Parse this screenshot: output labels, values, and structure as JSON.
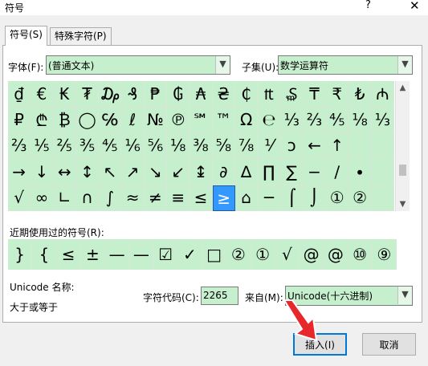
{
  "window": {
    "title": "符号",
    "help_glyph": "?",
    "close_glyph": "✕"
  },
  "tabs": [
    {
      "label": "符号(S)",
      "active": true
    },
    {
      "label": "特殊字符(P)",
      "active": false
    }
  ],
  "font": {
    "label": "字体(F):",
    "value": "(普通文本)"
  },
  "subset": {
    "label": "子集(U):",
    "value": "数学运算符"
  },
  "symbol_grid": [
    [
      "₫",
      "€",
      "₭",
      "₮",
      "₯",
      "₰",
      "₱",
      "₲",
      "₳",
      "₴",
      "₵",
      "₶",
      "₷",
      "₸",
      "₹",
      "₺",
      "₼"
    ],
    [
      "₽",
      "₾",
      "₿",
      "◯",
      "℅",
      "ℓ",
      "№",
      "℗",
      "℠",
      "™",
      "Ω",
      "℮",
      "⅓",
      "⅔",
      "⅘",
      "⅛",
      "⅓"
    ],
    [
      "⅔",
      "⅕",
      "⅖",
      "⅗",
      "⅘",
      "⅙",
      "⅚",
      "⅛",
      "⅜",
      "⅝",
      "⅞",
      "⅟",
      "ↄ",
      "←",
      "↑",
      "",
      ""
    ],
    [
      "→",
      "↓",
      "↔",
      "↕",
      "↖",
      "↗",
      "↘",
      "↙",
      "↨",
      "∂",
      "∆",
      "∏",
      "∑",
      "−",
      "∕",
      "∙",
      ""
    ],
    [
      "√",
      "∞",
      "∟",
      "∩",
      "∫",
      "≈",
      "≠",
      "≡",
      "≤",
      "≥",
      "⌂",
      "─",
      "⌠",
      "⌡",
      "①",
      "②",
      ""
    ]
  ],
  "selected_symbol": "≥",
  "recent": {
    "label": "近期使用过的符号(R):",
    "symbols": [
      "}",
      "{",
      "≤",
      "±",
      "—",
      "—",
      "☑",
      "✓",
      "□",
      "②",
      "①",
      "√",
      "@",
      "@",
      "⑩",
      "⑨"
    ]
  },
  "unicode": {
    "label": "Unicode 名称:",
    "name": "大于或等于"
  },
  "char_code": {
    "label": "字符代码(C):",
    "value": "2265"
  },
  "from": {
    "label": "来自(M):",
    "value": "Unicode(十六进制)"
  },
  "buttons": {
    "insert": "插入(I)",
    "cancel": "取消"
  },
  "colors": {
    "field_bg": "#c6efce",
    "selection": "#3399ff",
    "accent_arrow": "#e8272c",
    "default_border": "#0078d7"
  }
}
